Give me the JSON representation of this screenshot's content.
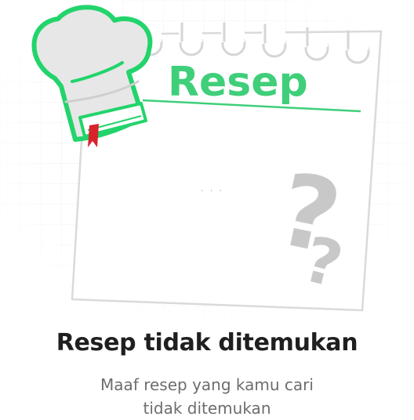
{
  "illustration": {
    "notepad_heading": "Resep",
    "notepad_placeholder": ". . .",
    "question_mark": "?",
    "colors": {
      "accent_green": "#3fcf7a",
      "hat_outline": "#22d46b",
      "ribbon_red": "#d8232a",
      "question_gray": "#c8c8c8",
      "grid_gray": "#eeeeee"
    }
  },
  "empty_state": {
    "title": "Resep tidak ditemukan",
    "message": "Maaf resep yang kamu cari tidak ditemukan"
  }
}
